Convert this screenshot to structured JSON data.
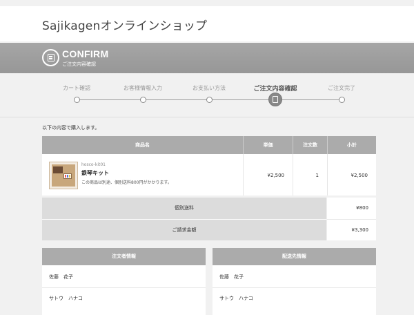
{
  "header": {
    "shop_title": "Sajikagenオンラインショップ"
  },
  "banner": {
    "title": "CONFIRM",
    "subtitle": "ご注文内容確認",
    "icon": "document-icon"
  },
  "steps": [
    {
      "label": "カート確認",
      "state": "done"
    },
    {
      "label": "お客様情報入力",
      "state": "done"
    },
    {
      "label": "お支払い方法",
      "state": "done"
    },
    {
      "label": "ご注文内容確認",
      "state": "current"
    },
    {
      "label": "ご注文完了",
      "state": "pending"
    }
  ],
  "intro": "以下の内容で購入します。",
  "table": {
    "headers": {
      "product": "商品名",
      "unit_price": "単価",
      "qty": "注文数",
      "subtotal": "小計"
    },
    "items": [
      {
        "code": "hosco-kit01",
        "name": "鉄琴キット",
        "note": "この商品は別途、個別送料800円がかかります。",
        "unit_price": "¥2,500",
        "qty": "1",
        "subtotal": "¥2,500"
      }
    ],
    "shipping": {
      "label": "個別送料",
      "value": "¥800"
    },
    "total": {
      "label": "ご請求金額",
      "value": "¥3,300"
    }
  },
  "orderer": {
    "title": "注文者情報",
    "name": "佐藤　花子",
    "kana": "サトウ　ハナコ"
  },
  "shipping_info": {
    "title": "配送先情報",
    "name": "佐藤　花子",
    "kana": "サトウ　ハナコ"
  },
  "colors": {
    "header_gray": "#ababab",
    "banner_gray": "#9e9e9e",
    "summary_gray": "#dcdcdc",
    "page_bg": "#f1f1f1"
  }
}
